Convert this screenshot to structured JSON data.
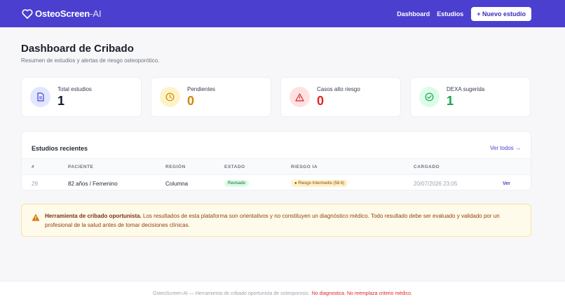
{
  "navbar": {
    "brand_name": "OsteoScreen",
    "brand_suffix": "-AI",
    "links": [
      "Dashboard",
      "Estudios"
    ],
    "new_study_button": "+ Nuevo estudio"
  },
  "header": {
    "title": "Dashboard de Cribado",
    "subtitle": "Resumen de estudios y alertas de riesgo osteoporótico."
  },
  "stats": [
    {
      "label": "Total estudios",
      "value": "1",
      "color": "#111827",
      "icon": "document-icon"
    },
    {
      "label": "Pendientes",
      "value": "0",
      "color": "#ca8a04",
      "icon": "clock-icon"
    },
    {
      "label": "Casos alto riesgo",
      "value": "0",
      "color": "#dc2626",
      "icon": "warning-icon"
    },
    {
      "label": "DEXA sugerida",
      "value": "1",
      "color": "#16a34a",
      "icon": "check-circle-icon"
    }
  ],
  "recent": {
    "title": "Estudios recientes",
    "view_all": "Ver todos →",
    "columns": [
      "#",
      "PACIENTE",
      "REGIÓN",
      "ESTADO",
      "RIESGO IA",
      "CARGADO"
    ],
    "rows": [
      {
        "id": "29",
        "patient": "82 años / Femenino",
        "region": "Columna",
        "status": "Revisado",
        "risk": "● Riesgo Intermedio (58.6)",
        "uploaded": "20/07/2026 23:05",
        "action": "Ver"
      }
    ]
  },
  "alert": {
    "bold": "Herramienta de cribado oportunista.",
    "text": " Los resultados de esta plataforma son orientativos y no constituyen un diagnóstico médico. Todo resultado debe ser evaluado y validado por un profesional de la salud antes de tomar decisiones clínicas."
  },
  "footer": {
    "text": "OsteoScreen-AI — Herramienta de cribado oportunista de osteoporosis.",
    "warning": "No diagnostica. No reemplaza criterio médico."
  },
  "colors": {
    "brand": "#4b3fd0",
    "danger": "#dc2626",
    "warning": "#ca8a04",
    "success": "#16a34a"
  }
}
